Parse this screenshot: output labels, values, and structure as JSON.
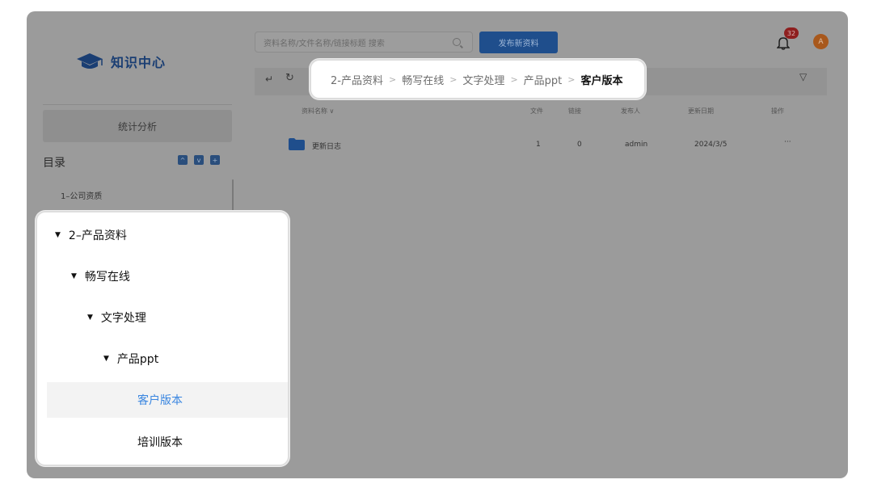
{
  "header": {
    "search_placeholder": "资料名称/文件名称/链接标题 搜索",
    "publish_label": "发布新资料",
    "notification_count": "32",
    "avatar_initial": "A"
  },
  "sidebar": {
    "logo_text": "知识中心",
    "stats_label": "统计分析",
    "catalog_title": "目录",
    "first_item": "1–公司资质"
  },
  "breadcrumb": [
    "2-产品资料",
    "畅写在线",
    "文字处理",
    "产品ppt",
    "客户版本"
  ],
  "table": {
    "headers": {
      "name": "资料名称 ∨",
      "files": "文件",
      "links": "链接",
      "publisher": "发布人",
      "updated": "更新日期",
      "actions": "操作"
    },
    "rows": [
      {
        "name": "更新日志",
        "files": "1",
        "links": "0",
        "publisher": "admin",
        "updated": "2024/3/5",
        "actions": "···"
      }
    ]
  },
  "tree": {
    "level1": "2–产品资料",
    "level2": "畅写在线",
    "level3": "文字处理",
    "level4": "产品ppt",
    "leaf_selected": "客户版本",
    "leaf_other": "培训版本"
  },
  "colors": {
    "accent": "#3a86e0",
    "primary_dark": "#1f4e8c",
    "badge": "#8e1f1f",
    "avatar": "#a8581c"
  }
}
